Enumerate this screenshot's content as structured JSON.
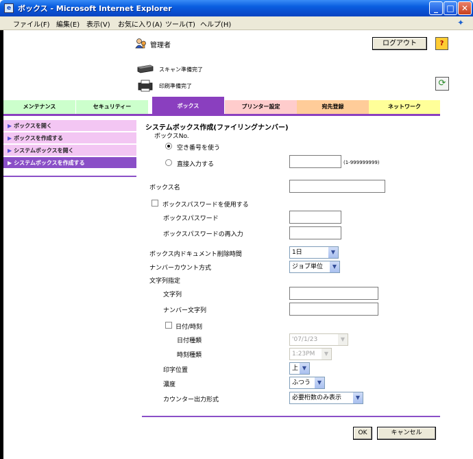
{
  "window": {
    "title": "ボックス - Microsoft Internet Explorer"
  },
  "menu": [
    "ファイル(F)",
    "編集(E)",
    "表示(V)",
    "お気に入り(A)",
    "ツール(T)",
    "ヘルプ(H)"
  ],
  "header": {
    "user": "管理者",
    "logout": "ログアウト",
    "help": "?",
    "scan_status": "スキャン準備完了",
    "print_status": "印刷準備完了"
  },
  "tabs": [
    {
      "label": "メンテナンス",
      "color": "#ccffcc"
    },
    {
      "label": "セキュリティー",
      "color": "#ccffcc"
    },
    {
      "label": "ボックス",
      "color": "#8a3fbf"
    },
    {
      "label": "プリンター設定",
      "color": "#ffcccc"
    },
    {
      "label": "宛先登録",
      "color": "#ffcc99"
    },
    {
      "label": "ネットワーク",
      "color": "#ffff99"
    }
  ],
  "active_tab": "ボックス",
  "sidebar": [
    {
      "label": "ボックスを開く"
    },
    {
      "label": "ボックスを作成する"
    },
    {
      "label": "システムボックスを開く"
    },
    {
      "label": "システムボックスを作成する"
    }
  ],
  "form": {
    "title": "システムボックス作成(ファイリングナンバー)",
    "box_no_label": "ボックスNo.",
    "radio_auto": "空き番号を使う",
    "radio_direct": "直接入力する",
    "box_no_value": "",
    "box_no_range": "(1-999999999)",
    "box_name_label": "ボックス名",
    "box_name_value": "",
    "use_password_label": "ボックスパスワードを使用する",
    "password_label": "ボックスパスワード",
    "password_confirm_label": "ボックスパスワードの再入力",
    "delete_time_label": "ボックス内ドキュメント削除時間",
    "delete_time_value": "1日",
    "count_method_label": "ナンバーカウント方式",
    "count_method_value": "ジョブ単位",
    "string_spec_label": "文字列指定",
    "string_label": "文字列",
    "number_string_label": "ナンバー文字列",
    "datetime_label": "日付/時刻",
    "date_type_label": "日付種類",
    "date_type_value": "'07/1/23",
    "time_type_label": "時刻種類",
    "time_type_value": "1:23PM",
    "print_pos_label": "印字位置",
    "print_pos_value": "上",
    "density_label": "濃度",
    "density_value": "ふつう",
    "counter_format_label": "カウンター出力形式",
    "counter_format_value": "必要桁数のみ表示",
    "ok": "OK",
    "cancel": "キャンセル"
  }
}
